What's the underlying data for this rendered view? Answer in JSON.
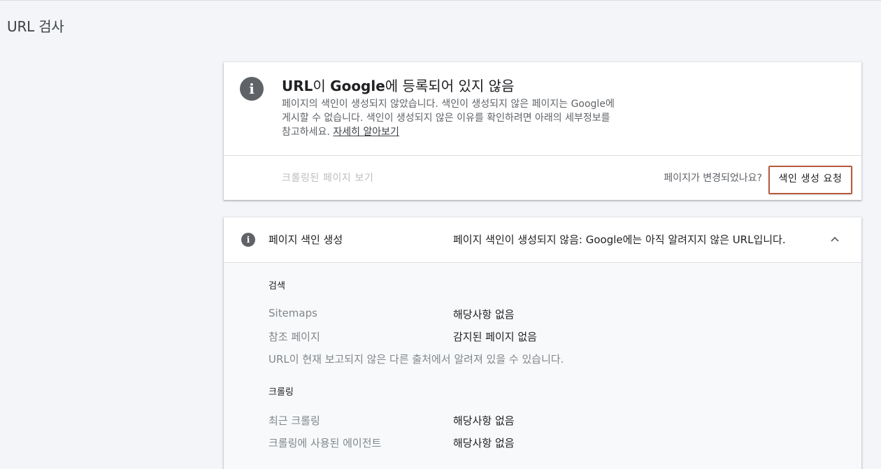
{
  "page": {
    "title": "URL 검사"
  },
  "status_card": {
    "icon": "info-icon",
    "title_prefix": "URL",
    "title_mid1": "이 ",
    "title_brand": "Google",
    "title_suffix": "에 등록되어 있지 않음",
    "description_line1": "페이지의 색인이 생성되지 않았습니다. 색인이 생성되지 않은 페이지는 Google에",
    "description_line2": "게시할 수 없습니다. 색인이 생성되지 않은 이유를 확인하려면 아래의 세부정보를",
    "description_line3": "참고하세요. ",
    "learn_more": "자세히 알아보기",
    "view_crawled_page": "크롤링된 페이지 보기",
    "page_changed_question": "페이지가 변경되었나요?",
    "request_indexing": "색인 생성 요청"
  },
  "indexing_panel": {
    "icon": "info-icon",
    "label": "페이지 색인 생성",
    "status": "페이지 색인이 생성되지 않음: Google에는 아직 알려지지 않은 URL입니다.",
    "expanded": true,
    "sections": {
      "discovery": {
        "title": "검색",
        "rows": [
          {
            "label": "Sitemaps",
            "value": "해당사항 없음"
          },
          {
            "label": "참조 페이지",
            "value": "감지된 페이지 없음"
          }
        ],
        "note": "URL이 현재 보고되지 않은 다른 출처에서 알려져 있을 수 있습니다."
      },
      "crawl": {
        "title": "크롤링",
        "rows": [
          {
            "label": "최근 크롤링",
            "value": "해당사항 없음"
          },
          {
            "label": "크롤링에 사용된 에이전트",
            "value": "해당사항 없음"
          }
        ]
      }
    }
  },
  "colors": {
    "background": "#f4f5f9",
    "icon_gray": "#5f6368",
    "request_button_border": "#b75a3c",
    "muted_link": "#bdbdbd"
  }
}
